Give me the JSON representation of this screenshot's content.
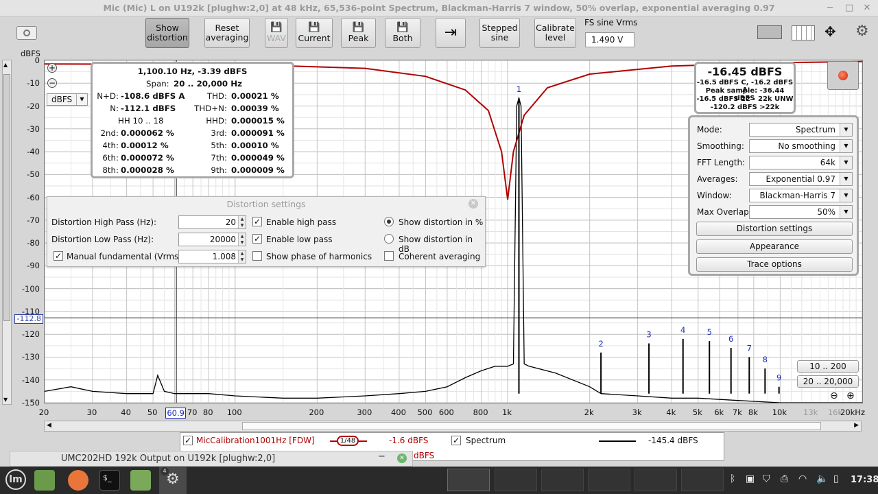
{
  "window": {
    "title": "Mic (Mic) L on U192k [plughw:2,0] at 48 kHz, 65,536-point Spectrum, Blackman-Harris 7 window, 50% overlap, exponential averaging 0.97"
  },
  "toolbar": {
    "show_distortion": [
      "Show",
      "distortion"
    ],
    "reset_averaging": [
      "Reset",
      "averaging"
    ],
    "wav": "WAV",
    "current": "Current",
    "peak": "Peak",
    "both": "Both",
    "stepped_sine": [
      "Stepped",
      "sine"
    ],
    "calibrate_level": [
      "Calibrate",
      "level"
    ],
    "fs_label": "FS sine Vrms",
    "fs_value": "1.490 V"
  },
  "axes": {
    "y_unit": "dBFS",
    "y_ticks": [
      "0",
      "-10",
      "-20",
      "-30",
      "-40",
      "-50",
      "-60",
      "-70",
      "-80",
      "-90",
      "-100",
      "-110",
      "-120",
      "-130",
      "-140",
      "-150"
    ],
    "x_ticks": [
      "20",
      "30",
      "40",
      "50",
      "60.9",
      "70",
      "80",
      "100",
      "200",
      "300",
      "400",
      "500",
      "600",
      "800",
      "1k",
      "2k",
      "3k",
      "4k",
      "5k",
      "6k",
      "7k",
      "8k",
      "10k",
      "13k",
      "16k",
      "20kHz"
    ],
    "cursor_x": "60.9",
    "cursor_y": "-112.8",
    "unit_select": "dBFS"
  },
  "chart_data": {
    "type": "line",
    "title": "",
    "xlabel": "",
    "ylabel": "dBFS",
    "x_scale": "log",
    "xlim": [
      20,
      20000
    ],
    "ylim": [
      -150,
      0
    ],
    "series": [
      {
        "name": "Spectrum",
        "color": "#000000",
        "x": [
          20,
          25,
          30,
          40,
          50,
          52,
          55,
          60,
          80,
          100,
          150,
          200,
          300,
          400,
          500,
          600,
          700,
          800,
          900,
          1000,
          1050,
          1080,
          1100,
          1120,
          1150,
          1200,
          1500,
          2000,
          2200,
          3000,
          4000,
          5000,
          7000,
          10000,
          15000,
          20000
        ],
        "y": [
          -145,
          -143,
          -145,
          -146,
          -146,
          -138,
          -145,
          -146,
          -146,
          -147,
          -148,
          -148,
          -147,
          -146,
          -145,
          -143,
          -139,
          -136,
          -134,
          -134,
          -133,
          -20,
          -16.5,
          -20,
          -133,
          -134,
          -137,
          -143,
          -146,
          -147,
          -148,
          -148,
          -149,
          -150,
          -150,
          -150
        ]
      },
      {
        "name": "MicCalibration1001Hz [FDW]",
        "color": "#b00000",
        "x": [
          20,
          100,
          300,
          500,
          700,
          850,
          950,
          1000,
          1050,
          1150,
          1400,
          2000,
          4000,
          10000,
          20000
        ],
        "y": [
          -1.6,
          -1.7,
          -3.5,
          -7,
          -13,
          -22,
          -40,
          -61,
          -40,
          -24,
          -12,
          -6,
          -2.5,
          -1,
          -0.5
        ]
      }
    ],
    "harmonics": [
      {
        "label": "1",
        "freq": 1100,
        "db": -16.5
      },
      {
        "label": "2",
        "freq": 2200,
        "db": -128
      },
      {
        "label": "3",
        "freq": 3300,
        "db": -124
      },
      {
        "label": "4",
        "freq": 4400,
        "db": -122
      },
      {
        "label": "5",
        "freq": 5500,
        "db": -123
      },
      {
        "label": "6",
        "freq": 6600,
        "db": -126
      },
      {
        "label": "7",
        "freq": 7700,
        "db": -130
      },
      {
        "label": "8",
        "freq": 8800,
        "db": -135
      },
      {
        "label": "9",
        "freq": 9900,
        "db": -143
      }
    ]
  },
  "info": {
    "peak": "1,100.10 Hz, -3.39 dBFS",
    "span_label": "Span:",
    "span_value": "20 .. 20,000 Hz",
    "nd_label": "N+D:",
    "nd_value": "-108.6 dBFS A",
    "thd_label": "THD:",
    "thd_value": "0.00021 %",
    "n_label": "N:",
    "n_value": "-112.1 dBFS",
    "thdn_label": "THD+N:",
    "thdn_value": "0.00039 %",
    "hh_label": "HH 10 .. 18",
    "hhd_label": "HHD:",
    "hhd_value": "0.000015 %",
    "h2_label": "2nd:",
    "h2_value": "0.000062 %",
    "h3_label": "3rd:",
    "h3_value": "0.000091 %",
    "h4_label": "4th:",
    "h4_value": "0.00012 %",
    "h5_label": "5th:",
    "h5_value": "0.00010 %",
    "h6_label": "6th:",
    "h6_value": "0.000072 %",
    "h7_label": "7th:",
    "h7_value": "0.000049 %",
    "h8_label": "8th:",
    "h8_value": "0.000028 %",
    "h9_label": "9th:",
    "h9_value": "0.000009 %"
  },
  "level": {
    "main": "-16.45 dBFS",
    "l1": "-16.5 dBFS C, -16.2 dBFS A",
    "l2": "Peak sample: -36.44 dBFS",
    "l3": "-16.5 dBFS 22 - 22k UNW",
    "l4": "-120.2 dBFS >22k"
  },
  "distortion_settings": {
    "title": "Distortion settings",
    "hp_label": "Distortion High Pass (Hz):",
    "hp_value": "20",
    "lp_label": "Distortion Low Pass (Hz):",
    "lp_value": "20000",
    "manual_label": "Manual fundamental (Vrms)",
    "manual_value": "1.008",
    "enable_hp": "Enable high pass",
    "enable_lp": "Enable low pass",
    "show_phase": "Show phase of harmonics",
    "show_pct": "Show distortion in %",
    "show_db": "Show distortion in dB",
    "coherent": "Coherent averaging"
  },
  "controls": {
    "mode_label": "Mode:",
    "mode_value": "Spectrum",
    "smoothing_label": "Smoothing:",
    "smoothing_value": "No  smoothing",
    "fft_label": "FFT Length:",
    "fft_value": "64k",
    "avg_label": "Averages:",
    "avg_value": "Exponential 0.97",
    "window_label": "Window:",
    "window_value": "Blackman-Harris 7",
    "overlap_label": "Max Overlap:",
    "overlap_value": "50%",
    "distortion_btn": "Distortion settings",
    "appearance_btn": "Appearance",
    "trace_btn": "Trace options"
  },
  "ranges": {
    "r1": "10 .. 200",
    "r2": "20 .. 20,000"
  },
  "legend": {
    "cal_name": "MicCalibration1001Hz [FDW]",
    "cal_smooth": "1/48",
    "cal_value": "-1.6 dBFS",
    "spec_name": "Spectrum",
    "spec_value": "-145.4 dBFS",
    "partial": "dBFS"
  },
  "umc_window": {
    "title": "UMC202HD 192k Output on U192k [plughw:2,0]"
  },
  "taskbar": {
    "clock": "17:38",
    "badge": "4"
  }
}
